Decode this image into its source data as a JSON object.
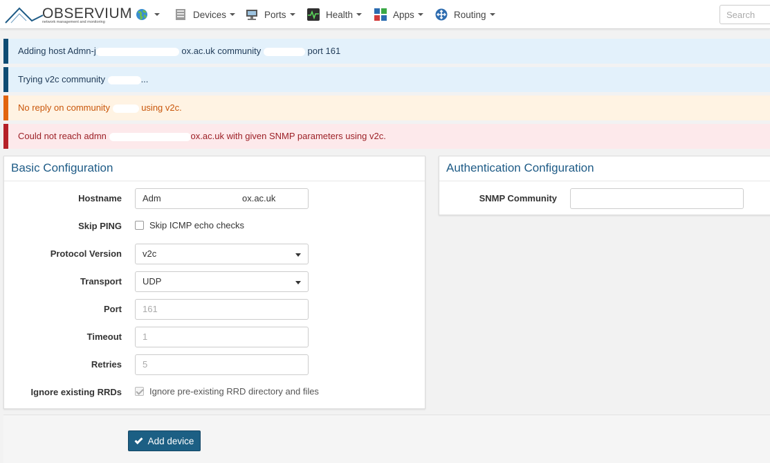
{
  "brand": {
    "name": "OBSERVIUM",
    "tagline": "network management and monitoring"
  },
  "nav": {
    "items": [
      {
        "label": "Devices"
      },
      {
        "label": "Ports"
      },
      {
        "label": "Health"
      },
      {
        "label": "Apps"
      },
      {
        "label": "Routing"
      }
    ],
    "search_placeholder": "Search"
  },
  "alerts": [
    {
      "type": "info",
      "parts": [
        "Adding host Admn-j",
        "ox.ac.uk community",
        "port 161"
      ]
    },
    {
      "type": "info",
      "parts": [
        "Trying v2c community",
        "..."
      ]
    },
    {
      "type": "warning",
      "parts": [
        "No reply on community",
        "using v2c."
      ]
    },
    {
      "type": "danger",
      "parts": [
        "Could not reach admn",
        "ox.ac.uk with given SNMP parameters using v2c."
      ]
    }
  ],
  "basic": {
    "title": "Basic Configuration",
    "hostname": {
      "label": "Hostname",
      "value_start": "Adm",
      "value_end": "ox.ac.uk"
    },
    "skip_ping": {
      "label": "Skip PING",
      "text": "Skip ICMP echo checks",
      "checked": false
    },
    "protocol": {
      "label": "Protocol Version",
      "value": "v2c"
    },
    "transport": {
      "label": "Transport",
      "value": "UDP"
    },
    "port": {
      "label": "Port",
      "placeholder": "161"
    },
    "timeout": {
      "label": "Timeout",
      "placeholder": "1"
    },
    "retries": {
      "label": "Retries",
      "placeholder": "5"
    },
    "ignore_rrd": {
      "label": "Ignore existing RRDs",
      "text": "Ignore pre-existing RRD directory and files",
      "checked": true
    }
  },
  "auth": {
    "title": "Authentication Configuration",
    "community": {
      "label": "SNMP Community",
      "value": ""
    }
  },
  "actions": {
    "add_label": "Add device"
  },
  "colors": {
    "accent": "#1c5f84",
    "title": "#1e5b86",
    "info_border": "#0f4c73",
    "warning_border": "#e2640e",
    "danger_border": "#b52128"
  }
}
